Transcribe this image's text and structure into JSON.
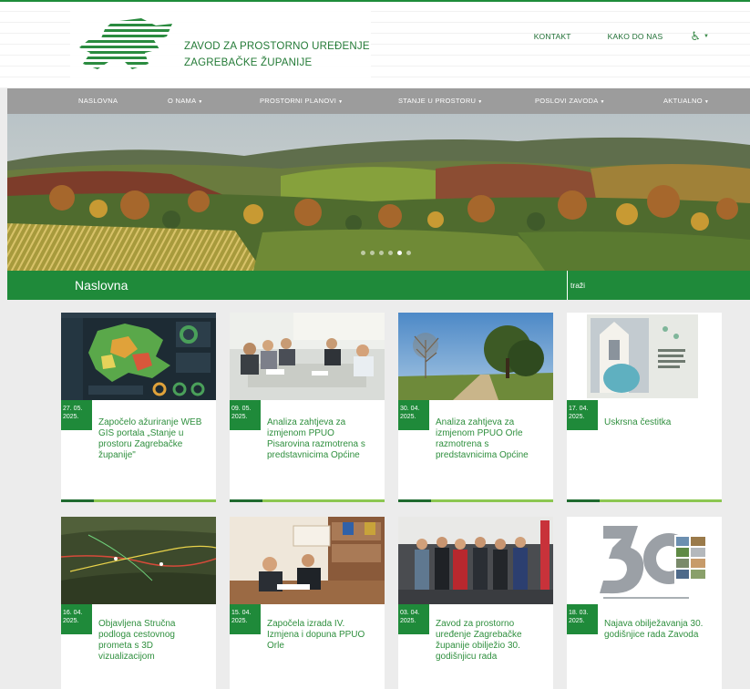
{
  "header": {
    "brand_line1": "ZAVOD ZA PROSTORNO UREĐENJE",
    "brand_line2": "ZAGREBAČKE ŽUPANIJE",
    "links": {
      "kontakt": "KONTAKT",
      "kako_do_nas": "KAKO DO NAS"
    },
    "accessibility_icon": "wheelchair-icon",
    "accessibility_glyph": "♿"
  },
  "nav": {
    "items": [
      {
        "label": "NASLOVNA",
        "dropdown": false
      },
      {
        "label": "O NAMA",
        "dropdown": true
      },
      {
        "label": "PROSTORNI PLANOVI",
        "dropdown": true
      },
      {
        "label": "STANJE U PROSTORU",
        "dropdown": true
      },
      {
        "label": "POSLOVI ZAVODA",
        "dropdown": true
      },
      {
        "label": "AKTUALNO",
        "dropdown": true
      }
    ],
    "caret": "▼"
  },
  "hero": {
    "slides": 6,
    "active_slide": 5
  },
  "page": {
    "title": "Naslovna",
    "search_placeholder": "traži"
  },
  "cards": [
    {
      "day": "27. 05.",
      "year": "2025.",
      "title": "Započelo ažuriranje WEB GIS portala „Stanje u prostoru Zagrebačke županije\""
    },
    {
      "day": "09. 05.",
      "year": "2025.",
      "title": "Analiza zahtjeva za izmjenom PPUO Pisarovina razmotrena s predstavnicima Općine"
    },
    {
      "day": "30. 04.",
      "year": "2025.",
      "title": "Analiza zahtjeva za izmjenom PPUO Orle razmotrena s predstavnicima Općine"
    },
    {
      "day": "17. 04.",
      "year": "2025.",
      "title": "Uskrsna čestitka"
    },
    {
      "day": "16. 04.",
      "year": "2025.",
      "title": "Objavljena Stručna podloga cestovnog prometa s 3D vizualizacijom"
    },
    {
      "day": "15. 04.",
      "year": "2025.",
      "title": "Započela izrada IV. Izmjena i dopuna PPUO Orle"
    },
    {
      "day": "03. 04.",
      "year": "2025.",
      "title": "Zavod za prostorno uređenje Zagrebačke županije obilježio 30. godišnjicu rada"
    },
    {
      "day": "18. 03.",
      "year": "2025.",
      "title": "Najava obilježavanja 30. godišnjice rada Zavoda"
    }
  ],
  "colors": {
    "brand_green": "#1f8a3a",
    "nav_gray": "#9c9c9c",
    "accent_light_green": "#8cc751"
  }
}
